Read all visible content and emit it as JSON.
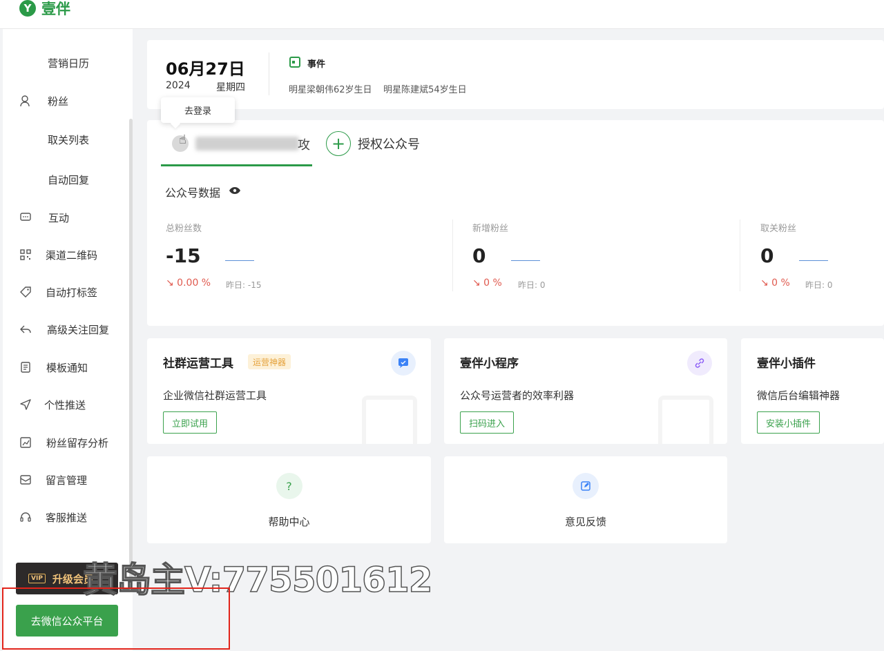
{
  "app": {
    "logo_mark": "Y",
    "logo_text": "壹伴"
  },
  "sidebar": {
    "items": [
      {
        "icon": "",
        "label": "营销日历"
      },
      {
        "icon": "fans-icon",
        "label": "粉丝"
      },
      {
        "icon": "",
        "label": "取关列表"
      },
      {
        "icon": "",
        "label": "自动回复"
      },
      {
        "icon": "chat-icon",
        "label": "互动"
      },
      {
        "icon": "qrcode-icon",
        "label": "渠道二维码"
      },
      {
        "icon": "tag-icon",
        "label": "自动打标签"
      },
      {
        "icon": "reply-icon",
        "label": "高级关注回复"
      },
      {
        "icon": "template-icon",
        "label": "模板通知"
      },
      {
        "icon": "send-icon",
        "label": "个性推送"
      },
      {
        "icon": "analysis-icon",
        "label": "粉丝留存分析"
      },
      {
        "icon": "message-icon",
        "label": "留言管理"
      },
      {
        "icon": "headset-icon",
        "label": "客服推送"
      }
    ],
    "vip_badge": "VIP",
    "vip_label": "升级会员",
    "wx_button": "去微信公众平台"
  },
  "date_panel": {
    "date": "06月27日",
    "year": "2024",
    "weekday": "星期四",
    "event_title": "事件",
    "events": "明星梁朝伟62岁生日    明星陈建斌54岁生日"
  },
  "tooltip": "去登录",
  "account": {
    "name_suffix": "攻",
    "authorize_label": "授权公众号",
    "section_title": "公众号数据",
    "stats": [
      {
        "label": "总粉丝数",
        "value": "-15",
        "trend": "↘ 0.00 %",
        "yesterday": "昨日: -15"
      },
      {
        "label": "新增粉丝",
        "value": "0",
        "trend": "↘ 0 %",
        "yesterday": "昨日: 0"
      },
      {
        "label": "取关粉丝",
        "value": "0",
        "trend": "↘ 0 %",
        "yesterday": "昨日: 0"
      }
    ]
  },
  "cards": [
    {
      "title": "社群运营工具",
      "badge": "运营神器",
      "desc": "企业微信社群运营工具",
      "button": "立即试用",
      "icon": "chat-bubble-icon",
      "icon_color": "#3b82f6",
      "icon_bg": "#e8f0fd"
    },
    {
      "title": "壹伴小程序",
      "desc": "公众号运营者的效率利器",
      "button": "扫码进入",
      "icon": "link-icon",
      "icon_color": "#8b5cf6",
      "icon_bg": "#f0ebfd"
    },
    {
      "title": "壹伴小插件",
      "desc": "微信后台编辑神器",
      "button": "安装小插件"
    }
  ],
  "help": [
    {
      "label": "帮助中心",
      "icon": "question-icon",
      "icon_color": "#3aa14c",
      "icon_bg": "#e9f6ec"
    },
    {
      "label": "意见反馈",
      "icon": "edit-icon",
      "icon_color": "#3b82f6",
      "icon_bg": "#e8f0fd"
    }
  ],
  "watermark": "黄岛主V:775501612"
}
